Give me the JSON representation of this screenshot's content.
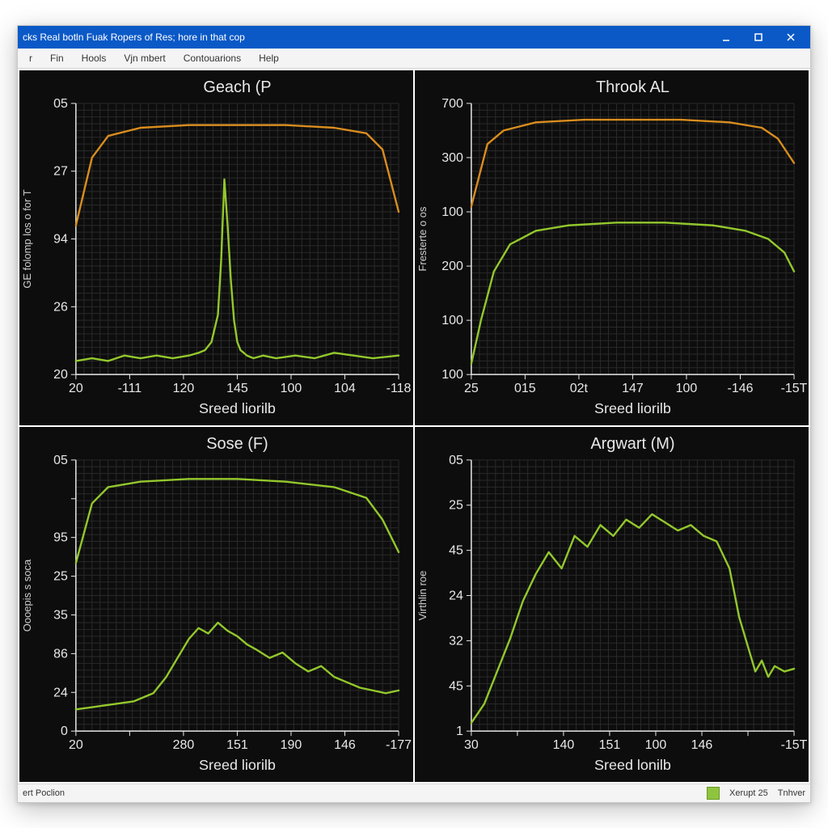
{
  "window": {
    "title": "cks Real botln Fuak Ropers of Res; hore in that cop"
  },
  "menu": {
    "items": [
      "r",
      "Fin",
      "Hools",
      "Vjn mbert",
      "Contouarions",
      "Help"
    ]
  },
  "status": {
    "left": "ert Poclion",
    "right1": "Xerupt 25",
    "right2": "Tnhver"
  },
  "colors": {
    "bg": "#0d0d0d",
    "grid": "#2a2a2a",
    "axis": "#e8e8e8",
    "seriesA": "#93c82c",
    "seriesB": "#d98d1e"
  },
  "chart_data": [
    {
      "id": "tl",
      "type": "line",
      "title": "Geach (P",
      "xlabel": "Sreed liorilb",
      "ylabel_side_text": "GE folomp los o for T",
      "x_ticks": [
        "20",
        "-111",
        "120",
        "145",
        "100",
        "104",
        "-118"
      ],
      "y_ticks": [
        "05",
        "27",
        "94",
        "26",
        "20"
      ],
      "series": [
        {
          "name": "envelope",
          "color": "#d98d1e",
          "x": [
            0,
            0.05,
            0.1,
            0.2,
            0.35,
            0.5,
            0.65,
            0.8,
            0.9,
            0.95,
            1.0
          ],
          "y": [
            0.55,
            0.8,
            0.88,
            0.91,
            0.92,
            0.92,
            0.92,
            0.91,
            0.89,
            0.83,
            0.6
          ]
        },
        {
          "name": "signal",
          "color": "#93c82c",
          "x": [
            0,
            0.05,
            0.1,
            0.15,
            0.2,
            0.25,
            0.3,
            0.35,
            0.38,
            0.4,
            0.42,
            0.44,
            0.45,
            0.46,
            0.47,
            0.48,
            0.49,
            0.5,
            0.51,
            0.52,
            0.53,
            0.55,
            0.58,
            0.62,
            0.68,
            0.74,
            0.8,
            0.86,
            0.92,
            1.0
          ],
          "y": [
            0.05,
            0.06,
            0.05,
            0.07,
            0.06,
            0.07,
            0.06,
            0.07,
            0.08,
            0.09,
            0.12,
            0.22,
            0.42,
            0.72,
            0.55,
            0.35,
            0.2,
            0.12,
            0.09,
            0.08,
            0.07,
            0.06,
            0.07,
            0.06,
            0.07,
            0.06,
            0.08,
            0.07,
            0.06,
            0.07
          ]
        }
      ]
    },
    {
      "id": "tr",
      "type": "line",
      "title": "Throok AL",
      "xlabel": "Sreed liorilb",
      "ylabel_side_text": "Fresterte o os",
      "x_ticks": [
        "25",
        "015",
        "02t",
        "147",
        "100",
        "-146",
        "-15T"
      ],
      "y_ticks": [
        "700",
        "300",
        "100",
        "200",
        "100",
        "100"
      ],
      "series": [
        {
          "name": "envelope",
          "color": "#d98d1e",
          "x": [
            0,
            0.05,
            0.1,
            0.2,
            0.35,
            0.5,
            0.65,
            0.8,
            0.9,
            0.95,
            1.0
          ],
          "y": [
            0.62,
            0.85,
            0.9,
            0.93,
            0.94,
            0.94,
            0.94,
            0.93,
            0.91,
            0.87,
            0.78
          ]
        },
        {
          "name": "curve",
          "color": "#93c82c",
          "x": [
            0,
            0.03,
            0.07,
            0.12,
            0.2,
            0.3,
            0.45,
            0.6,
            0.75,
            0.85,
            0.92,
            0.97,
            1.0
          ],
          "y": [
            0.04,
            0.2,
            0.38,
            0.48,
            0.53,
            0.55,
            0.56,
            0.56,
            0.55,
            0.53,
            0.5,
            0.45,
            0.38
          ]
        }
      ]
    },
    {
      "id": "bl",
      "type": "line",
      "title": "Sose (F)",
      "xlabel": "Sreed liorilb",
      "ylabel_side_text": "Oooepis s soca",
      "x_ticks": [
        "20",
        "",
        "280",
        "151",
        "190",
        "146",
        "-177"
      ],
      "y_ticks": [
        "05",
        "",
        "95",
        "25",
        "35",
        "86",
        "24",
        "0"
      ],
      "series": [
        {
          "name": "envelope",
          "color": "#93c82c",
          "x": [
            0,
            0.05,
            0.1,
            0.2,
            0.35,
            0.5,
            0.65,
            0.8,
            0.9,
            0.95,
            1.0
          ],
          "y": [
            0.62,
            0.84,
            0.9,
            0.92,
            0.93,
            0.93,
            0.92,
            0.9,
            0.86,
            0.78,
            0.66
          ]
        },
        {
          "name": "signal",
          "color": "#93c82c",
          "x": [
            0,
            0.06,
            0.12,
            0.18,
            0.24,
            0.28,
            0.32,
            0.35,
            0.38,
            0.41,
            0.44,
            0.47,
            0.5,
            0.53,
            0.56,
            0.6,
            0.64,
            0.68,
            0.72,
            0.76,
            0.8,
            0.84,
            0.88,
            0.92,
            0.96,
            1.0
          ],
          "y": [
            0.08,
            0.09,
            0.1,
            0.11,
            0.14,
            0.2,
            0.28,
            0.34,
            0.38,
            0.36,
            0.4,
            0.37,
            0.35,
            0.32,
            0.3,
            0.27,
            0.29,
            0.25,
            0.22,
            0.24,
            0.2,
            0.18,
            0.16,
            0.15,
            0.14,
            0.15
          ]
        }
      ]
    },
    {
      "id": "br",
      "type": "line",
      "title": "Argwart (M)",
      "xlabel": "Sreed lonilb",
      "ylabel_side_text": "Virthlin roe",
      "x_ticks": [
        "30",
        "",
        "140",
        "151",
        "100",
        "146",
        "",
        "-15T"
      ],
      "y_ticks": [
        "05",
        "25",
        "45",
        "24",
        "32",
        "45",
        "1"
      ],
      "series": [
        {
          "name": "signal",
          "color": "#93c82c",
          "x": [
            0,
            0.04,
            0.08,
            0.12,
            0.16,
            0.2,
            0.24,
            0.28,
            0.32,
            0.36,
            0.4,
            0.44,
            0.48,
            0.52,
            0.56,
            0.6,
            0.64,
            0.68,
            0.72,
            0.76,
            0.8,
            0.83,
            0.86,
            0.88,
            0.9,
            0.92,
            0.94,
            0.97,
            1.0
          ],
          "y": [
            0.03,
            0.1,
            0.22,
            0.34,
            0.48,
            0.58,
            0.66,
            0.6,
            0.72,
            0.68,
            0.76,
            0.72,
            0.78,
            0.75,
            0.8,
            0.77,
            0.74,
            0.76,
            0.72,
            0.7,
            0.6,
            0.42,
            0.3,
            0.22,
            0.26,
            0.2,
            0.24,
            0.22,
            0.23
          ]
        }
      ]
    }
  ]
}
